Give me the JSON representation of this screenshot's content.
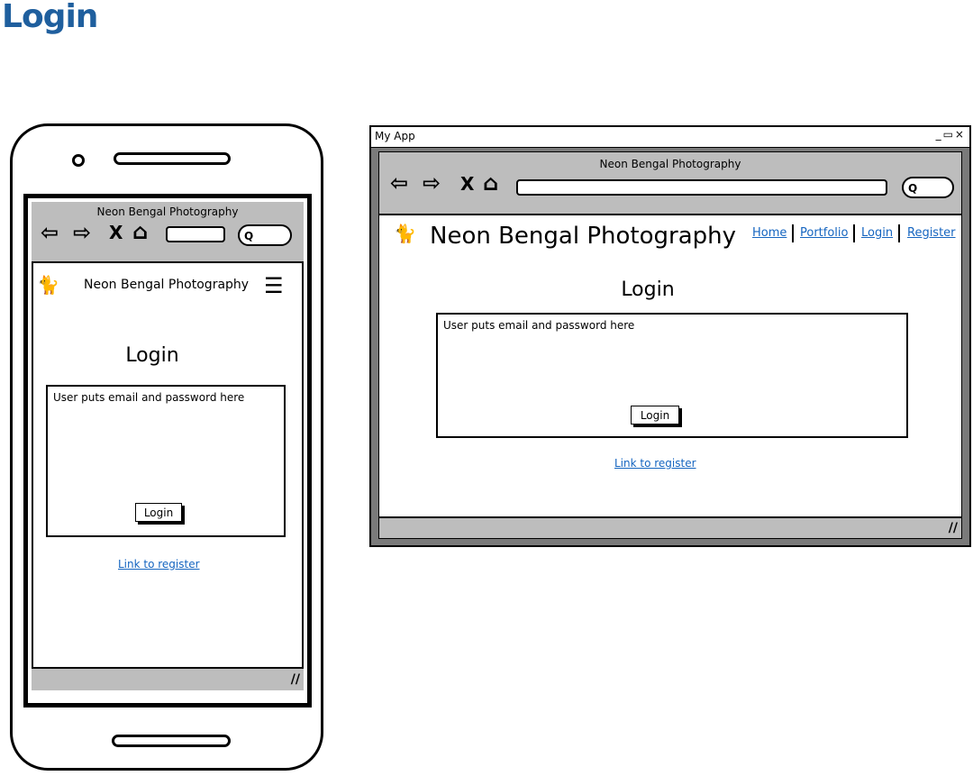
{
  "page": {
    "title": "Login"
  },
  "site": {
    "name": "Neon Bengal Photography",
    "logo_glyph": "🐈"
  },
  "browser": {
    "back_glyph": "⇦",
    "forward_glyph": "⇨",
    "stop_glyph": "X",
    "home_glyph": "⌂",
    "search_glyph": "Q"
  },
  "mobile": {
    "menu_glyph": "☰",
    "login_heading": "Login",
    "form_text": "User puts email and password here",
    "login_button": "Login",
    "register_link": "Link to register",
    "resize_glyph": "//"
  },
  "desktop": {
    "window_title": "My App",
    "window_controls": "_▭×",
    "nav": [
      "Home",
      "Portfolio",
      "Login",
      "Register"
    ],
    "login_heading": "Login",
    "form_text": "User puts email and password here",
    "login_button": "Login",
    "register_link": "Link to register",
    "resize_glyph": "//"
  },
  "colors": {
    "title_blue": "#1f5f9e",
    "link_blue": "#1565c0",
    "chrome_gray": "#bdbdbd",
    "frame_gray": "#7a7a7a"
  }
}
